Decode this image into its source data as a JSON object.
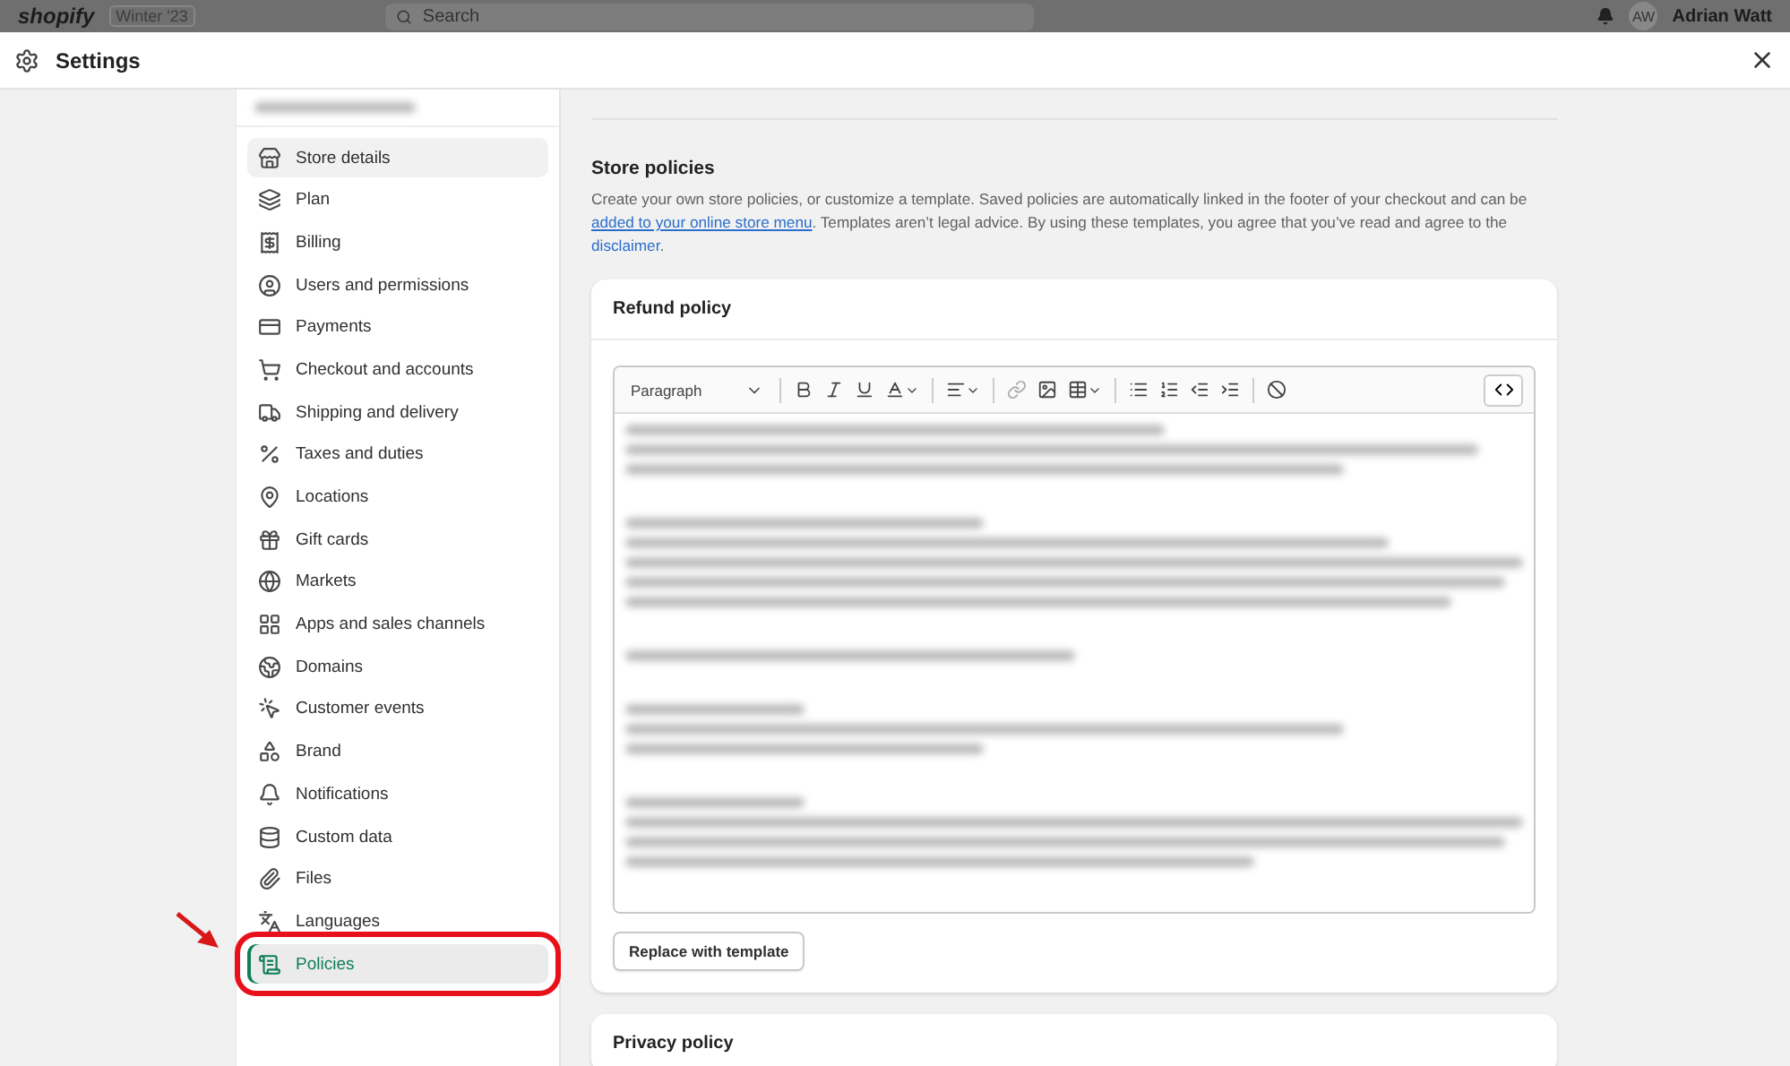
{
  "background_bar": {
    "logo": "shopify",
    "badge": "Winter '23",
    "search": {
      "placeholder": "Search"
    },
    "avatar": "AW",
    "user": "Adrian Watt"
  },
  "window": {
    "title": "Settings"
  },
  "sidebar": {
    "items": [
      {
        "label": "Store details",
        "selected": false,
        "hovered": true,
        "annotated": false
      },
      {
        "label": "Plan",
        "selected": false,
        "hovered": false,
        "annotated": false
      },
      {
        "label": "Billing",
        "selected": false,
        "hovered": false,
        "annotated": false
      },
      {
        "label": "Users and permissions",
        "selected": false,
        "hovered": false,
        "annotated": false
      },
      {
        "label": "Payments",
        "selected": false,
        "hovered": false,
        "annotated": false
      },
      {
        "label": "Checkout and accounts",
        "selected": false,
        "hovered": false,
        "annotated": false
      },
      {
        "label": "Shipping and delivery",
        "selected": false,
        "hovered": false,
        "annotated": false
      },
      {
        "label": "Taxes and duties",
        "selected": false,
        "hovered": false,
        "annotated": false
      },
      {
        "label": "Locations",
        "selected": false,
        "hovered": false,
        "annotated": false
      },
      {
        "label": "Gift cards",
        "selected": false,
        "hovered": false,
        "annotated": false
      },
      {
        "label": "Markets",
        "selected": false,
        "hovered": false,
        "annotated": false
      },
      {
        "label": "Apps and sales channels",
        "selected": false,
        "hovered": false,
        "annotated": false
      },
      {
        "label": "Domains",
        "selected": false,
        "hovered": false,
        "annotated": false
      },
      {
        "label": "Customer events",
        "selected": false,
        "hovered": false,
        "annotated": false
      },
      {
        "label": "Brand",
        "selected": false,
        "hovered": false,
        "annotated": false
      },
      {
        "label": "Notifications",
        "selected": false,
        "hovered": false,
        "annotated": false
      },
      {
        "label": "Custom data",
        "selected": false,
        "hovered": false,
        "annotated": false
      },
      {
        "label": "Files",
        "selected": false,
        "hovered": false,
        "annotated": false
      },
      {
        "label": "Languages",
        "selected": false,
        "hovered": false,
        "annotated": false
      },
      {
        "label": "Policies",
        "selected": true,
        "hovered": false,
        "annotated": true
      }
    ]
  },
  "section": {
    "title": "Store policies",
    "description": [
      {
        "kind": "text",
        "text": "Create your own store policies, or customize a template. Saved policies are automatically linked in the footer of your checkout and can be "
      },
      {
        "kind": "link",
        "text": "added to your online store menu",
        "underlined": true
      },
      {
        "kind": "text",
        "text": ". Templates aren’t legal advice. By using these templates, you agree that you’ve read and agree to the "
      },
      {
        "kind": "link",
        "text": "disclaimer",
        "underlined": false
      },
      {
        "kind": "text",
        "text": "."
      }
    ]
  },
  "cards": [
    {
      "title": "Refund policy",
      "editor": {
        "format": "Paragraph"
      },
      "button": "Replace with template"
    },
    {
      "title": "Privacy policy"
    }
  ]
}
